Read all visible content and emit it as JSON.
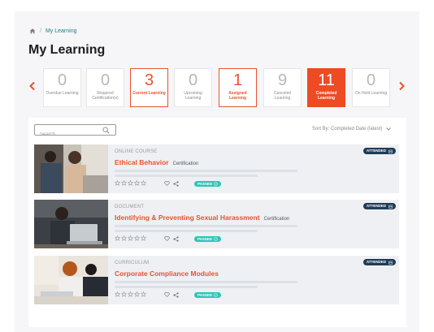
{
  "breadcrumb": {
    "current": "My Learning",
    "separator": "/"
  },
  "page": {
    "title": "My Learning"
  },
  "stats": [
    {
      "value": "0",
      "label": "Overdue Learning",
      "style": "default"
    },
    {
      "value": "0",
      "label": "Required Certification(s)",
      "style": "default"
    },
    {
      "value": "3",
      "label": "Current Learning",
      "style": "outlined"
    },
    {
      "value": "0",
      "label": "Upcoming Learning",
      "style": "default"
    },
    {
      "value": "1",
      "label": "Assigned Learning",
      "style": "outlined"
    },
    {
      "value": "9",
      "label": "Canceled Learning",
      "style": "default"
    },
    {
      "value": "11",
      "label": "Completed Learning",
      "style": "filled"
    },
    {
      "value": "0",
      "label": "On Hold Learning",
      "style": "default"
    }
  ],
  "search": {
    "placeholder": "Search"
  },
  "sort": {
    "label": "Sort By: Completed Date (latest)"
  },
  "courses": [
    {
      "type": "ONLINE COURSE",
      "title": "Ethical Behavior",
      "tag": "Certification",
      "status": "PASSED",
      "badge": "ATTENDED"
    },
    {
      "type": "DOCUMENT",
      "title": "Identifying & Preventing Sexual Harassment",
      "tag": "Certification",
      "status": "PASSED",
      "badge": "ATTENDED"
    },
    {
      "type": "CURRICULUM",
      "title": "Corporate Compliance Modules",
      "tag": "",
      "status": "PASSED",
      "badge": "ATTENDED"
    }
  ],
  "colors": {
    "accent": "#ee4a23",
    "badge": "#1f3c58",
    "passed": "#2fc5b5",
    "link": "#1f7a8c"
  },
  "icons": {
    "home": "home-icon",
    "search": "search-icon",
    "prev": "chevron-left-icon",
    "next": "chevron-right-icon",
    "sort": "chevron-down-icon",
    "star": "star-outline-icon",
    "heart": "heart-icon",
    "share": "share-icon",
    "check": "check-circle-icon",
    "calendar": "calendar-icon"
  }
}
